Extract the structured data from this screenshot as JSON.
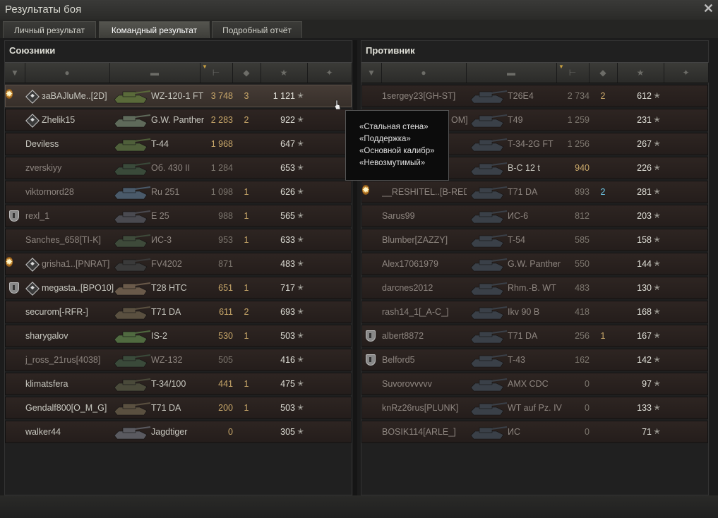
{
  "window": {
    "title": "Результаты боя",
    "close": "✕"
  },
  "tabs": [
    {
      "label": "Личный результат",
      "active": false
    },
    {
      "label": "Командный результат",
      "active": true
    },
    {
      "label": "Подробный отчёт",
      "active": false
    }
  ],
  "allies": {
    "title": "Союзники",
    "rows": [
      {
        "name": "зaBAJluMe..[2D]",
        "tank": "WZ-120-1 FT",
        "damage": "3 748",
        "kills": "3",
        "xp": "1 121",
        "medal": true,
        "squad": true,
        "clan": false,
        "highlight": true,
        "dim": false,
        "tank_color": "#5a6a3a"
      },
      {
        "name": "Zhelik15",
        "tank": "G.W. Panther",
        "damage": "2 283",
        "kills": "2",
        "xp": "922",
        "medal": false,
        "squad": true,
        "clan": false,
        "highlight": false,
        "dim": false,
        "tank_color": "#5f6a5a"
      },
      {
        "name": "Deviless",
        "tank": "T-44",
        "damage": "1 968",
        "kills": "",
        "xp": "647",
        "medal": false,
        "squad": false,
        "clan": false,
        "highlight": false,
        "dim": false,
        "tank_color": "#4f5f3a"
      },
      {
        "name": "zverskiyy",
        "tank": "Об. 430 II",
        "damage": "1 284",
        "kills": "",
        "xp": "653",
        "medal": false,
        "squad": false,
        "clan": false,
        "highlight": false,
        "dim": true,
        "tank_color": "#3a4a3a"
      },
      {
        "name": "viktornord28",
        "tank": "Ru 251",
        "damage": "1 098",
        "kills": "1",
        "xp": "626",
        "medal": false,
        "squad": false,
        "clan": false,
        "highlight": false,
        "dim": true,
        "tank_color": "#4a5a6a"
      },
      {
        "name": "rexl_1",
        "tank": "E 25",
        "damage": "988",
        "kills": "1",
        "xp": "565",
        "medal": false,
        "squad": false,
        "clan": true,
        "highlight": false,
        "dim": true,
        "tank_color": "#4a4a50"
      },
      {
        "name": "Sanches_658[TI-K]",
        "tank": "ИС-3",
        "damage": "953",
        "kills": "1",
        "xp": "633",
        "medal": false,
        "squad": false,
        "clan": false,
        "highlight": false,
        "dim": true,
        "tank_color": "#3e4a3a"
      },
      {
        "name": "grisha1..[PNRAT]",
        "tank": "FV4202",
        "damage": "871",
        "kills": "",
        "xp": "483",
        "medal": true,
        "squad": true,
        "clan": false,
        "highlight": false,
        "dim": true,
        "tank_color": "#3a3a3a"
      },
      {
        "name": "megasta..[BPO10]",
        "tank": "T28 HTC",
        "damage": "651",
        "kills": "1",
        "xp": "717",
        "medal": false,
        "squad": true,
        "clan": true,
        "highlight": false,
        "dim": false,
        "tank_color": "#6a5a4a"
      },
      {
        "name": "securom[-RFR-]",
        "tank": "T71 DA",
        "damage": "611",
        "kills": "2",
        "xp": "693",
        "medal": false,
        "squad": false,
        "clan": false,
        "highlight": false,
        "dim": false,
        "tank_color": "#5a5040"
      },
      {
        "name": "sharygalov",
        "tank": "IS-2",
        "damage": "530",
        "kills": "1",
        "xp": "503",
        "medal": false,
        "squad": false,
        "clan": false,
        "highlight": false,
        "dim": false,
        "tank_color": "#506a40"
      },
      {
        "name": "j_ross_21rus[4038]",
        "tank": "WZ-132",
        "damage": "505",
        "kills": "",
        "xp": "416",
        "medal": false,
        "squad": false,
        "clan": false,
        "highlight": false,
        "dim": true,
        "tank_color": "#3a4a3a"
      },
      {
        "name": "klimatsfera",
        "tank": "T-34/100",
        "damage": "441",
        "kills": "1",
        "xp": "475",
        "medal": false,
        "squad": false,
        "clan": false,
        "highlight": false,
        "dim": false,
        "tank_color": "#4a4a3a"
      },
      {
        "name": "Gendalf800[O_M_G]",
        "tank": "T71 DA",
        "damage": "200",
        "kills": "1",
        "xp": "503",
        "medal": false,
        "squad": false,
        "clan": false,
        "highlight": false,
        "dim": false,
        "tank_color": "#5a5040"
      },
      {
        "name": "walker44",
        "tank": "Jagdtiger",
        "damage": "0",
        "kills": "",
        "xp": "305",
        "medal": false,
        "squad": false,
        "clan": false,
        "highlight": false,
        "dim": false,
        "tank_color": "#5a5a60"
      }
    ]
  },
  "enemies": {
    "title": "Противник",
    "rows": [
      {
        "name": "1sergey23[GH-ST]",
        "tank": "T26E4",
        "damage": "2 734",
        "kills": "2",
        "xp": "612",
        "medal": false,
        "clan": false,
        "dim": true,
        "kills_blue": false,
        "tank_color": "#3a4048"
      },
      {
        "name": "",
        "tank": "T49",
        "damage": "1 259",
        "kills": "",
        "xp": "231",
        "medal": false,
        "clan": false,
        "dim": true,
        "kills_blue": false,
        "tank_color": "#3a4048"
      },
      {
        "name": "",
        "tank": "T-34-2G FT",
        "damage": "1 256",
        "kills": "",
        "xp": "267",
        "medal": false,
        "clan": false,
        "dim": true,
        "kills_blue": false,
        "tank_color": "#3a4048"
      },
      {
        "name": "",
        "tank": "В-С 12 t",
        "damage": "940",
        "kills": "",
        "xp": "226",
        "medal": false,
        "clan": false,
        "dim": false,
        "kills_blue": false,
        "tank_color": "#3a4048"
      },
      {
        "name": "__RESHITEL..[B-RED]",
        "tank": "T71 DA",
        "damage": "893",
        "kills": "2",
        "xp": "281",
        "medal": true,
        "clan": false,
        "dim": true,
        "kills_blue": true,
        "tank_color": "#3a4048"
      },
      {
        "name": "Sarus99",
        "tank": "ИС-6",
        "damage": "812",
        "kills": "",
        "xp": "203",
        "medal": false,
        "clan": false,
        "dim": true,
        "kills_blue": false,
        "tank_color": "#3a4048"
      },
      {
        "name": "Blumber[ZAZZY]",
        "tank": "T-54",
        "damage": "585",
        "kills": "",
        "xp": "158",
        "medal": false,
        "clan": false,
        "dim": true,
        "kills_blue": false,
        "tank_color": "#3a4048"
      },
      {
        "name": "Alex17061979",
        "tank": "G.W. Panther",
        "damage": "550",
        "kills": "",
        "xp": "144",
        "medal": false,
        "clan": false,
        "dim": true,
        "kills_blue": false,
        "tank_color": "#3a4048"
      },
      {
        "name": "darcnes2012",
        "tank": "Rhm.-B. WT",
        "damage": "483",
        "kills": "",
        "xp": "130",
        "medal": false,
        "clan": false,
        "dim": true,
        "kills_blue": false,
        "tank_color": "#3a4048"
      },
      {
        "name": "rash14_1[_A-C_]",
        "tank": "Ikv 90 B",
        "damage": "418",
        "kills": "",
        "xp": "168",
        "medal": false,
        "clan": false,
        "dim": true,
        "kills_blue": false,
        "tank_color": "#3a4048"
      },
      {
        "name": "albert8872",
        "tank": "T71 DA",
        "damage": "256",
        "kills": "1",
        "xp": "167",
        "medal": false,
        "clan": true,
        "dim": true,
        "kills_blue": false,
        "tank_color": "#3a4048"
      },
      {
        "name": "Belford5",
        "tank": "T-43",
        "damage": "162",
        "kills": "",
        "xp": "142",
        "medal": false,
        "clan": true,
        "dim": true,
        "kills_blue": false,
        "tank_color": "#3a4048"
      },
      {
        "name": "Suvorovvvvv",
        "tank": "AMX CDC",
        "damage": "0",
        "kills": "",
        "xp": "97",
        "medal": false,
        "clan": false,
        "dim": true,
        "kills_blue": false,
        "tank_color": "#3a4048"
      },
      {
        "name": "knRz26rus[PLUNK]",
        "tank": "WT auf Pz. IV",
        "damage": "0",
        "kills": "",
        "xp": "133",
        "medal": false,
        "clan": false,
        "dim": true,
        "kills_blue": false,
        "tank_color": "#3a4048"
      },
      {
        "name": "BOSIK114[ARLE_]",
        "tank": "ИС",
        "damage": "0",
        "kills": "",
        "xp": "71",
        "medal": false,
        "clan": false,
        "dim": true,
        "kills_blue": false,
        "tank_color": "#3a4048"
      }
    ]
  },
  "tooltip": {
    "partial_name": "OM]",
    "lines": [
      "«Стальная стена»",
      "«Поддержка»",
      "«Основной калибр»",
      "«Невозмутимый»"
    ]
  },
  "symbols": {
    "star": "✭",
    "medal": "✸",
    "sort": "▼"
  },
  "colors": {
    "damage": "#c9a86a",
    "kills_blue": "#6ec8e8",
    "medal": "#e0a040"
  }
}
